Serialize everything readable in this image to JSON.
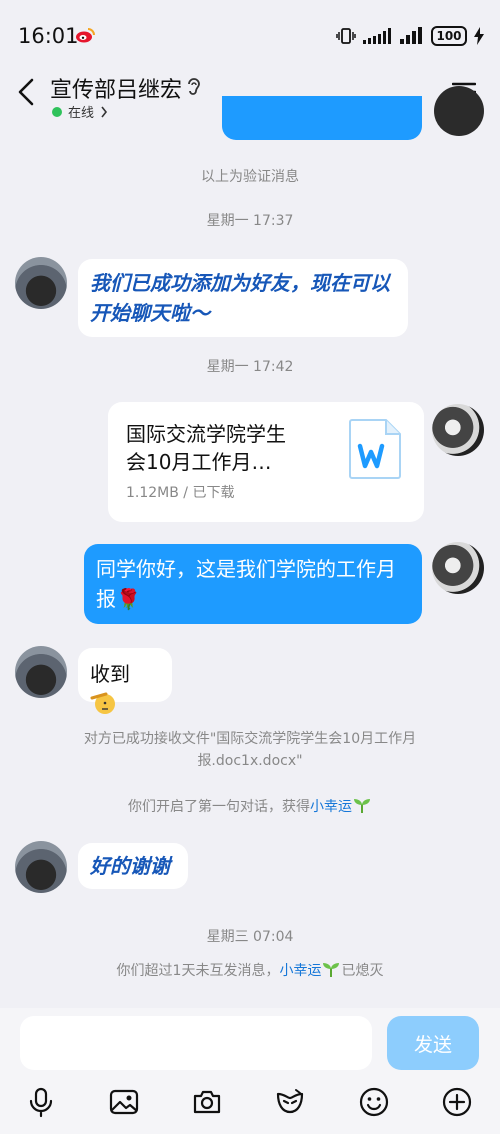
{
  "status_bar": {
    "time": "16:01",
    "battery": "100"
  },
  "header": {
    "title": "宣传部吕继宏",
    "online_status": "在线"
  },
  "messages": {
    "verify_notice": "以上为验证消息",
    "time1": "星期一 17:37",
    "friend_added": "我们已成功添加为好友，现在可以开始聊天啦～",
    "time2": "星期一 17:42",
    "file": {
      "name_line1": "国际交流学院学生",
      "name_line2": "会10月工作月…",
      "meta": "1.12MB / 已下载"
    },
    "greeting": "同学你好，这是我们学院的工作月报🌹",
    "received": "收到",
    "file_received_line1": "对方已成功接收文件\"国际交流学院学生会10月工作月",
    "file_received_line2": "报.doc1x.docx\"",
    "first_chat_prefix": "你们开启了第一句对话，获得",
    "first_chat_link": "小幸运",
    "thanks": "好的谢谢",
    "time3": "星期三 07:04",
    "expired_prefix": "你们超过1天未互发消息，",
    "expired_link": "小幸运",
    "expired_suffix": "已熄灭"
  },
  "input": {
    "placeholder": "",
    "send_label": "发送"
  },
  "toolbar": [
    "microphone-icon",
    "image-icon",
    "camera-icon",
    "hongbao-icon",
    "emoji-icon",
    "plus-icon"
  ],
  "colors": {
    "accent": "#1e9bff",
    "send_disabled": "#8dcdfd",
    "online": "#2fc25b",
    "link": "#1677d8"
  }
}
